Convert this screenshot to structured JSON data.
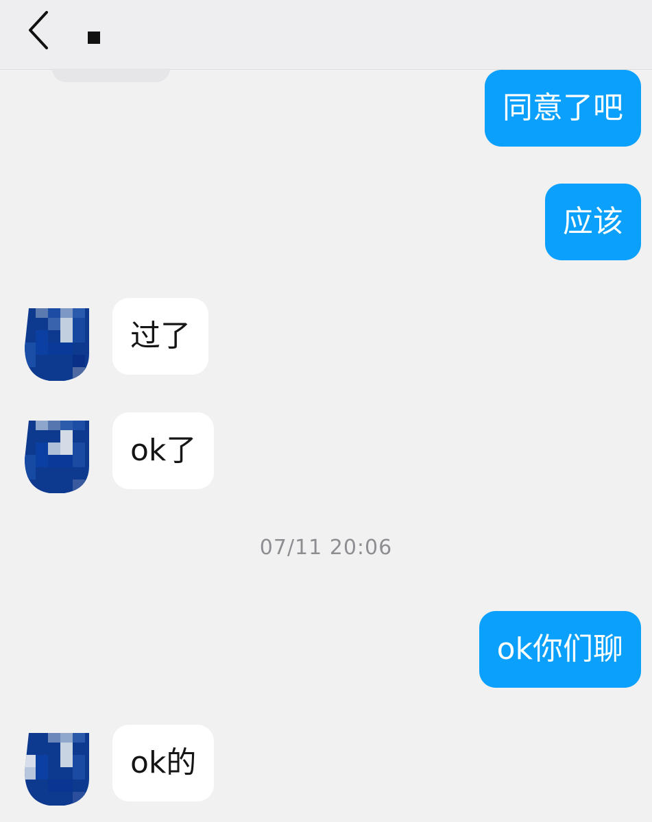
{
  "header": {
    "back_icon": "chevron-left-icon",
    "title": "."
  },
  "messages": [
    {
      "side": "out",
      "text": "同意了吧"
    },
    {
      "side": "out",
      "text": "应该"
    },
    {
      "side": "in",
      "text": "过了"
    },
    {
      "side": "in",
      "text": "ok了"
    },
    {
      "side": "out",
      "text": "ok你们聊"
    },
    {
      "side": "in",
      "text": "ok的"
    }
  ],
  "timestamp": "07/11 20:06",
  "colors": {
    "outgoing_bubble": "#0aa0fb",
    "incoming_bubble": "#ffffff",
    "background": "#f1f1f2",
    "avatar_pixelated": "#0d3d9a"
  }
}
